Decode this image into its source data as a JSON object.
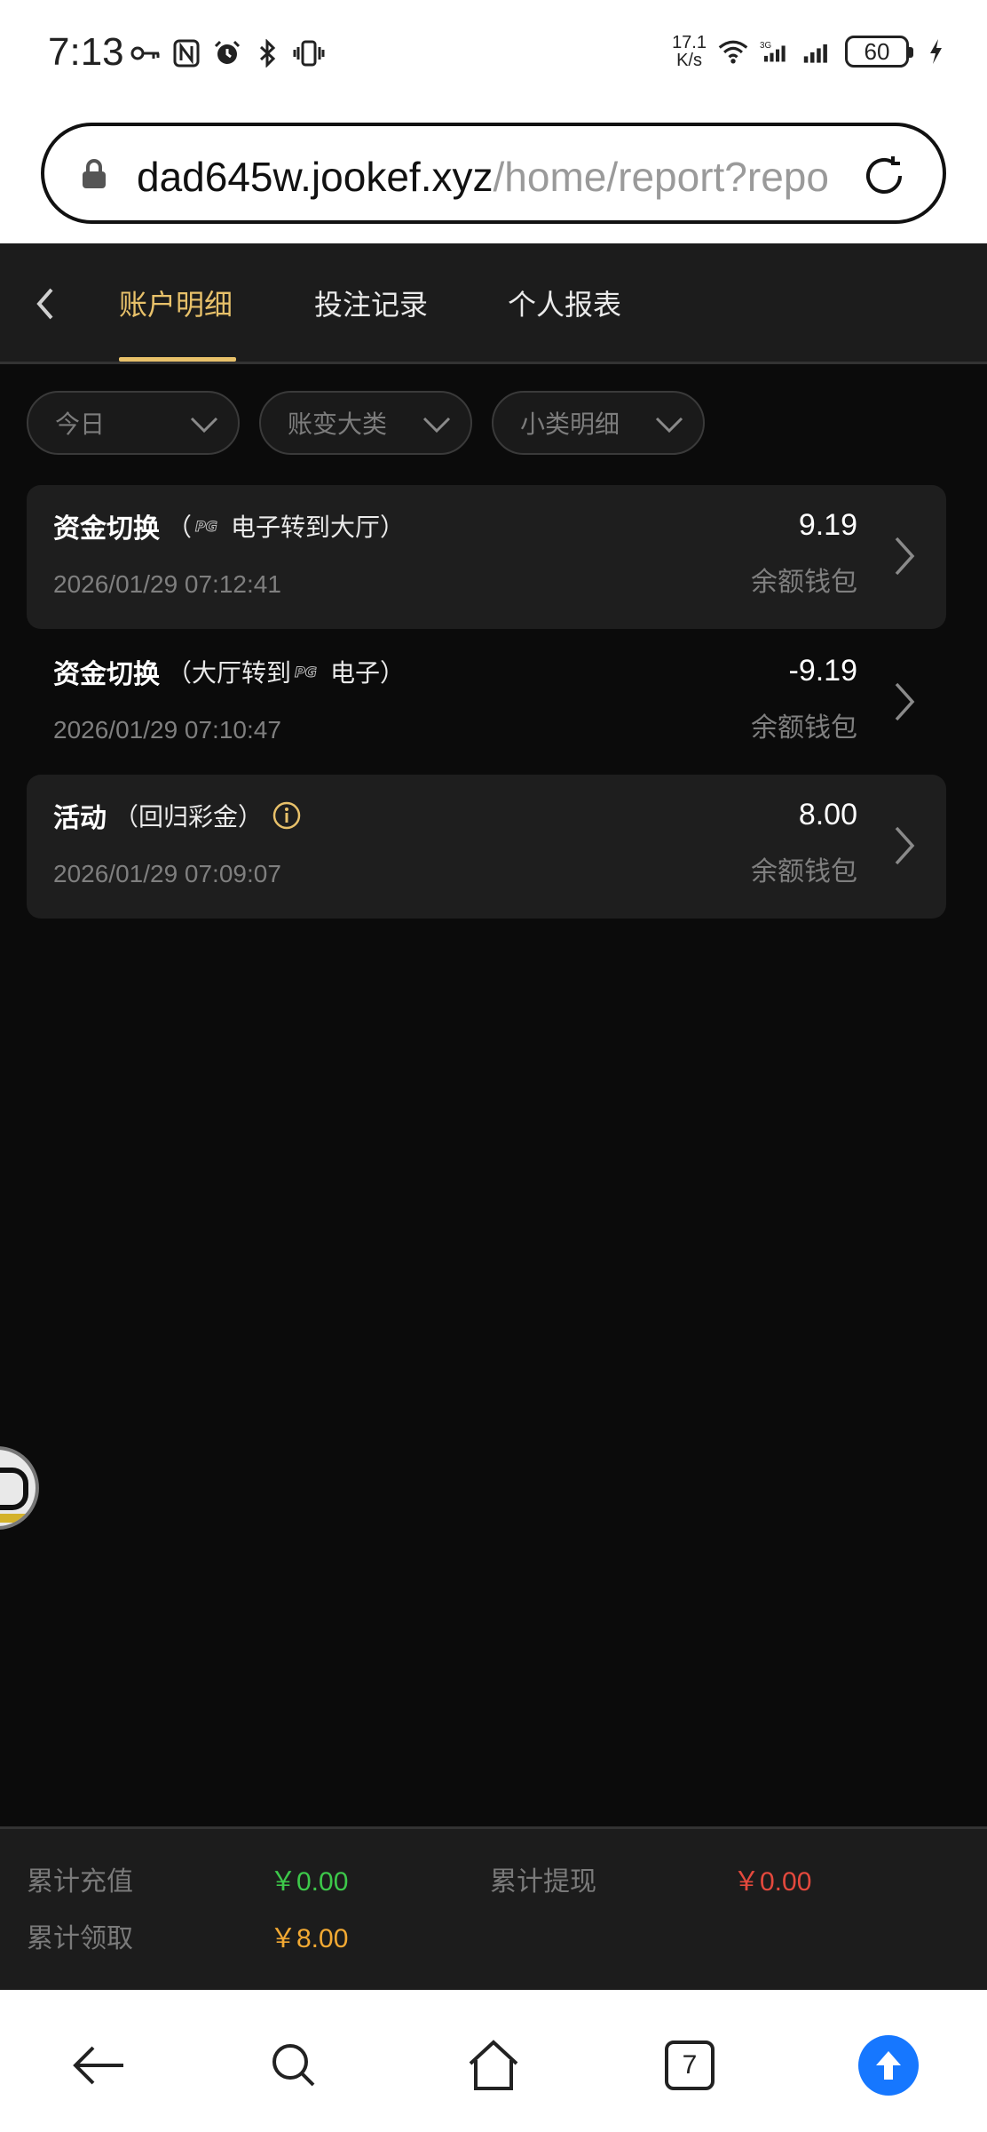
{
  "status_bar": {
    "time": "7:13",
    "net_speed_value": "17.1",
    "net_speed_unit": "K/s",
    "battery": "60"
  },
  "browser": {
    "url_domain": "dad645w.jookef.xyz",
    "url_path": "/home/report?repo"
  },
  "nav": {
    "tabs": [
      {
        "label": "账户明细",
        "active": true
      },
      {
        "label": "投注记录",
        "active": false
      },
      {
        "label": "个人报表",
        "active": false
      }
    ]
  },
  "filters": [
    {
      "label": "今日"
    },
    {
      "label": "账变大类"
    },
    {
      "label": "小类明细"
    }
  ],
  "records": [
    {
      "title": "资金切换",
      "sub_prefix": "（",
      "sub_logo": "PG",
      "sub_text": "电子转到大厅）",
      "time": "2026/01/29 07:12:41",
      "amount": "9.19",
      "wallet": "余额钱包"
    },
    {
      "title": "资金切换",
      "sub_text_before": "（大厅转到",
      "sub_logo": "PG",
      "sub_text_after": "电子）",
      "time": "2026/01/29 07:10:47",
      "amount": "-9.19",
      "wallet": "余额钱包"
    },
    {
      "title": "活动",
      "sub_text": "（回归彩金）",
      "time": "2026/01/29 07:09:07",
      "amount": "8.00",
      "wallet": "余额钱包"
    }
  ],
  "summary": {
    "recharge_label": "累计充值",
    "recharge_value": "￥0.00",
    "withdraw_label": "累计提现",
    "withdraw_value": "￥0.00",
    "claim_label": "累计领取",
    "claim_value": "￥8.00"
  },
  "bottom_nav": {
    "tab_count": "7"
  },
  "colors": {
    "accent": "#e8c16a",
    "positive": "#3dc84a",
    "negative": "#e4493d",
    "claim": "#f2a933",
    "upload": "#1677ff"
  }
}
